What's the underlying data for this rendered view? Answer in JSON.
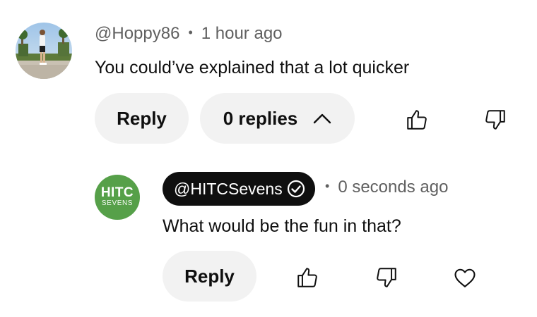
{
  "comment": {
    "author": "@Hoppy86",
    "separator": "•",
    "timestamp": "1 hour ago",
    "text": "You could’ve explained that a lot quicker",
    "reply_label": "Reply",
    "replies_label": "0 replies",
    "avatar_icon": "user-photo-avatar",
    "like_icon": "thumbs-up-icon",
    "dislike_icon": "thumbs-down-icon"
  },
  "reply": {
    "avatar_line1": "HITC",
    "avatar_line2": "SEVENS",
    "author": "@HITCSevens",
    "verified_icon": "verified-check-icon",
    "separator": "•",
    "timestamp": "0 seconds ago",
    "text": "What would be the fun in that?",
    "reply_label": "Reply",
    "like_icon": "thumbs-up-icon",
    "dislike_icon": "thumbs-down-icon",
    "heart_icon": "heart-icon"
  },
  "colors": {
    "pill_bg": "#f2f2f2",
    "meta_text": "#606060",
    "handle_bg": "#0f0f0f",
    "brand_green": "#56a049"
  }
}
